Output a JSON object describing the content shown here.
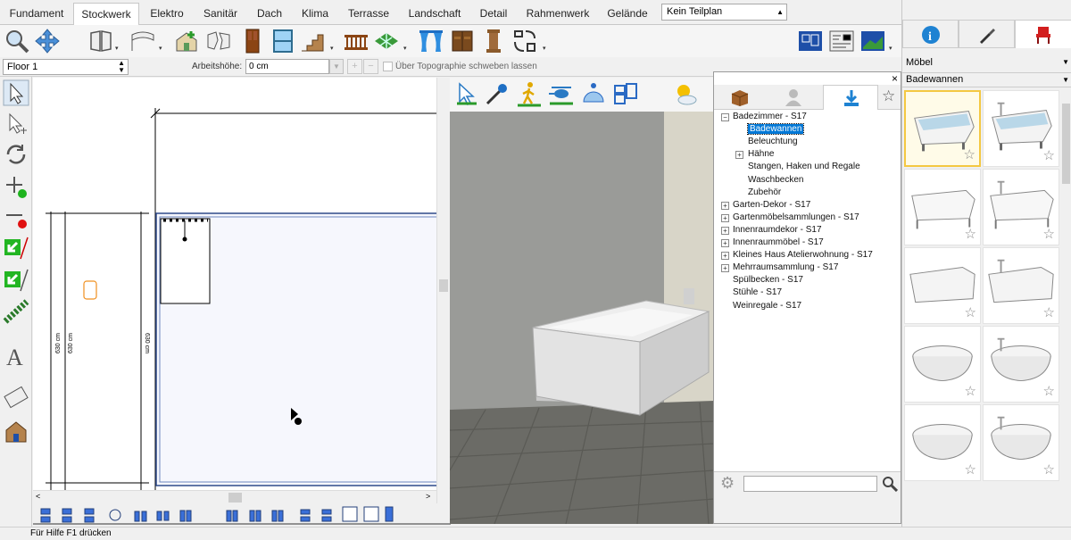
{
  "tabs": [
    "Fundament",
    "Stockwerk",
    "Elektro",
    "Sanitär",
    "Dach",
    "Klima",
    "Terrasse",
    "Landschaft",
    "Detail",
    "Rahmenwerk",
    "Gelände"
  ],
  "teilplan": "Kein Teilplan",
  "floor": "Floor 1",
  "arbeitshoehe_label": "Arbeitshöhe:",
  "arbeitshoehe_value": "0 cm",
  "topo_label": "Über Topographie schweben lassen",
  "dims": {
    "a": "630 cm",
    "b": "630 cm",
    "c": "630 cm"
  },
  "library": {
    "tree": [
      {
        "label": "Badezimmer - S17",
        "level": 0,
        "expander": "minus",
        "children": [
          {
            "label": "Badewannen",
            "selected": true
          },
          {
            "label": "Beleuchtung"
          },
          {
            "label": "Hähne",
            "expander": "plus"
          },
          {
            "label": "Stangen, Haken und Regale"
          },
          {
            "label": "Waschbecken"
          },
          {
            "label": "Zubehör"
          }
        ]
      },
      {
        "label": "Garten-Dekor - S17",
        "expander": "plus"
      },
      {
        "label": "Gartenmöbelsammlungen - S17",
        "expander": "plus"
      },
      {
        "label": "Innenraumdekor - S17",
        "expander": "plus"
      },
      {
        "label": "Innenraummöbel - S17",
        "expander": "plus"
      },
      {
        "label": "Kleines Haus Atelierwohnung - S17",
        "expander": "plus"
      },
      {
        "label": "Mehrraumsammlung - S17",
        "expander": "plus"
      },
      {
        "label": "Spülbecken - S17"
      },
      {
        "label": "Stühle - S17"
      },
      {
        "label": "Weinregale - S17"
      }
    ],
    "search_value": ""
  },
  "right_panel": {
    "category": "Möbel",
    "subcategory": "Badewannen",
    "thumbs": 10
  },
  "status": "Für Hilfe F1 drücken",
  "colors": {
    "accent": "#f4c842",
    "selection": "#0078d7",
    "wall": "#9db4d6"
  }
}
